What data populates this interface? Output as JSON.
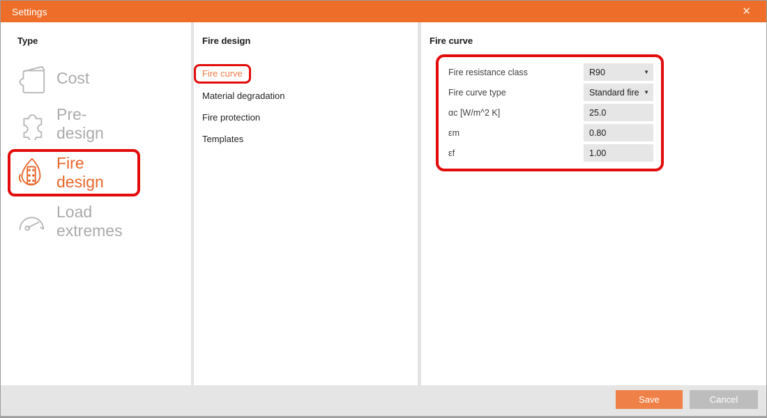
{
  "window": {
    "title": "Settings",
    "close_glyph": "✕"
  },
  "colors": {
    "titlebar_orange": "#EE6E29",
    "active_orange": "#E8662B",
    "save_orange": "#EF8148",
    "highlight_red": "#E30B0B",
    "inactive_gray": "#ABABAB",
    "field_bg": "#E6E6E6",
    "footer_bg": "#E5E5E5",
    "cancel_gray": "#BDBDBD"
  },
  "sidebar": {
    "heading": "Type",
    "items": [
      {
        "label": "Cost",
        "icon": "wallet-icon",
        "active": false
      },
      {
        "label": "Pre-design",
        "icon": "puzzle-icon",
        "active": false
      },
      {
        "label": "Fire design",
        "icon": "flame-column-icon",
        "active": true
      },
      {
        "label": "Load extremes",
        "icon": "gauge-icon",
        "active": false
      }
    ]
  },
  "submenu": {
    "heading": "Fire design",
    "items": [
      {
        "label": "Fire curve",
        "active": true
      },
      {
        "label": "Material degradation",
        "active": false
      },
      {
        "label": "Fire protection",
        "active": false
      },
      {
        "label": "Templates",
        "active": false
      }
    ]
  },
  "panel": {
    "heading": "Fire curve",
    "fields": [
      {
        "label": "Fire resistance class",
        "value": "R90",
        "type": "dropdown"
      },
      {
        "label": "Fire curve type",
        "value": "Standard fire",
        "type": "dropdown"
      },
      {
        "label": "αc [W/m^2 K]",
        "value": "25.0",
        "type": "input"
      },
      {
        "label": "εm",
        "value": "0.80",
        "type": "input"
      },
      {
        "label": "εf",
        "value": "1.00",
        "type": "input"
      }
    ],
    "caret_glyph": "▼"
  },
  "footer": {
    "save_label": "Save",
    "cancel_label": "Cancel"
  }
}
